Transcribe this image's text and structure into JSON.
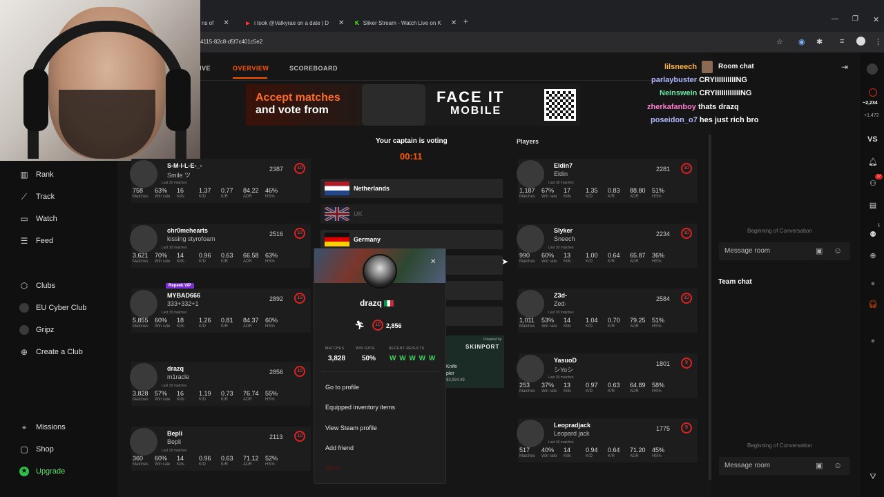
{
  "browser": {
    "tabs": [
      {
        "label": "ns of",
        "close": "✕"
      },
      {
        "label": "i took @Valkyrae on a date | D",
        "close": "✕"
      },
      {
        "label": "Sliker Stream - Watch Live on K",
        "close": "✕"
      }
    ],
    "new_tab": "+",
    "url": "4115-82c8-d5f7c401c5e2"
  },
  "topnav": {
    "live": "IVE",
    "overview": "OVERVIEW",
    "scoreboard": "SCOREBOARD"
  },
  "banner": {
    "line1": "Accept matches",
    "line2": "and vote from",
    "brand1": "FACE IT",
    "brand2": "MOBILE"
  },
  "sidebar": {
    "items": [
      {
        "label": "Rank",
        "icon": "rank-icon"
      },
      {
        "label": "Track",
        "icon": "track-icon"
      },
      {
        "label": "Watch",
        "icon": "watch-icon"
      },
      {
        "label": "Feed",
        "icon": "feed-icon"
      },
      {
        "label": "Clubs",
        "icon": "clubs-icon"
      },
      {
        "label": "EU Cyber Club",
        "icon": "club-avatar"
      },
      {
        "label": "Gripz",
        "icon": "club-avatar"
      },
      {
        "label": "Create a Club",
        "icon": "plus-icon"
      },
      {
        "label": "Missions",
        "icon": "missions-icon"
      },
      {
        "label": "Shop",
        "icon": "shop-icon"
      },
      {
        "label": "Upgrade",
        "icon": "upgrade-icon"
      }
    ]
  },
  "stat_labels": {
    "matches": "Matches",
    "winrate": "Win rate",
    "kills": "Kills",
    "kd": "K/D",
    "kr": "K/R",
    "adr": "ADR",
    "hs": "HS%",
    "last": "Last 30 matches"
  },
  "team_left": [
    {
      "name": "S-M-I-L-E-_-",
      "sub": "Smile ツ",
      "elo": "2387",
      "level": "10",
      "matches": "758",
      "winrate": "63%",
      "kills": "16",
      "kd": "1.37",
      "kr": "0.77",
      "adr": "84.22",
      "hs": "46%"
    },
    {
      "name": "chr0mehearts",
      "sub": "kissing styrofoam",
      "elo": "2516",
      "level": "10",
      "matches": "3,621",
      "winrate": "70%",
      "kills": "14",
      "kd": "0.96",
      "kr": "0.63",
      "adr": "66.58",
      "hs": "63%"
    },
    {
      "name": "MYBAD666",
      "sub": "333+332+1",
      "badge": "Repeek VIP",
      "elo": "2892",
      "level": "10",
      "matches": "5,855",
      "winrate": "60%",
      "kills": "18",
      "kd": "1.26",
      "kr": "0.81",
      "adr": "84.37",
      "hs": "60%"
    },
    {
      "name": "drazq",
      "sub": "m1racle",
      "elo": "2856",
      "level": "10",
      "matches": "3,828",
      "winrate": "57%",
      "kills": "16",
      "kd": "1.19",
      "kr": "0.73",
      "adr": "76.74",
      "hs": "55%"
    },
    {
      "name": "Bepli",
      "sub": "Bepli",
      "elo": "2113",
      "level": "10",
      "matches": "360",
      "winrate": "60%",
      "kills": "14",
      "kd": "0.96",
      "kr": "0.63",
      "adr": "71.12",
      "hs": "52%"
    }
  ],
  "team_right": [
    {
      "name": "Eldin7",
      "sub": "Eldin",
      "elo": "2281",
      "level": "10",
      "matches": "1,187",
      "winrate": "67%",
      "kills": "17",
      "kd": "1.35",
      "kr": "0.83",
      "adr": "88.80",
      "hs": "51%"
    },
    {
      "name": "Slyker",
      "sub": "Sneech",
      "elo": "2234",
      "level": "10",
      "matches": "990",
      "winrate": "60%",
      "kills": "13",
      "kd": "1.00",
      "kr": "0.64",
      "adr": "65.87",
      "hs": "36%"
    },
    {
      "name": "Z3d-",
      "sub": "Zed-",
      "elo": "2584",
      "level": "10",
      "matches": "1,011",
      "winrate": "53%",
      "kills": "14",
      "kd": "1.04",
      "kr": "0.70",
      "adr": "79.25",
      "hs": "51%"
    },
    {
      "name": "YasuoD",
      "sub": "シYoシ",
      "elo": "1801",
      "level": "9",
      "matches": "253",
      "winrate": "37%",
      "kills": "13",
      "kd": "0.97",
      "kr": "0.63",
      "adr": "64.89",
      "hs": "58%"
    },
    {
      "name": "Leopradjack",
      "sub": "Leopard jack",
      "elo": "1775",
      "level": "9",
      "matches": "517",
      "winrate": "40%",
      "kills": "14",
      "kd": "0.94",
      "kr": "0.64",
      "adr": "71.20",
      "hs": "45%"
    }
  ],
  "vote": {
    "title": "Your captain is voting",
    "timer": "00:11",
    "maps": [
      {
        "label": "Netherlands",
        "flag": "NL"
      },
      {
        "label": "UK",
        "flag": "UK"
      },
      {
        "label": "Germany",
        "flag": "DE"
      }
    ],
    "powered_by": "Powered by",
    "powered_brand": "SKINPORT",
    "knife1": "Knife",
    "knife2": "pler",
    "knife3": "$3,934.49"
  },
  "popover": {
    "name": "drazq",
    "elo": "2,856",
    "level": "10",
    "labels": {
      "matches": "MATCHES",
      "winrate": "WIN RATE",
      "recent": "RECENT RESULTS"
    },
    "matches": "3,828",
    "winrate": "50%",
    "recent": "W W W W W",
    "menu": [
      "Go to profile",
      "Equipped inventory items",
      "View Steam profile",
      "Add friend",
      "Block"
    ]
  },
  "players_title": "Players",
  "chat": {
    "room_title": "Room chat",
    "streamer": "lilsneech",
    "messages": [
      {
        "user": "parlaybuster",
        "text": "CRYIIIIIIIIIING"
      },
      {
        "user": "Neinswein",
        "text": "CRYIIIIIIIIIIIING"
      },
      {
        "user": "zherkafanboy",
        "text": "thats drazq"
      },
      {
        "user": "poseidon_o7",
        "text": "hes just rich bro"
      }
    ],
    "beginning": "Beginning of Conversation",
    "placeholder": "Message room",
    "team_title": "Team chat"
  },
  "rightrail": {
    "viewers": "~2,234",
    "followers": "+1,472",
    "vs": "VS",
    "notif_count": "27",
    "badge": "1"
  },
  "colors": {
    "accent": "#ff5500",
    "level_red": "#e02424",
    "bg": "#161616"
  }
}
